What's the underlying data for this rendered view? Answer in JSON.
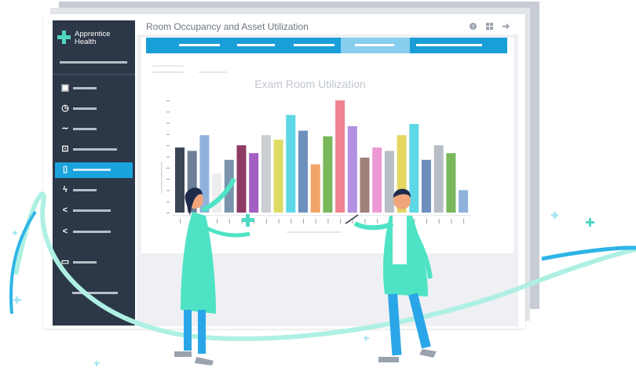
{
  "window": {
    "title": "Room Occupancy and Asset Utilization",
    "toolbar_icons": [
      "help-icon",
      "grid-icon",
      "logout-icon"
    ]
  },
  "brand": {
    "name_line1": "Apprentice",
    "name_line2": "Health",
    "accent": "#1aa3dc",
    "logo_color": "#4fd8c4",
    "sidebar_color": "#2c3747"
  },
  "sidebar": {
    "active_index": 4,
    "items": [
      {
        "icon": "dashboard-icon"
      },
      {
        "icon": "clock-icon"
      },
      {
        "icon": "trend-icon"
      },
      {
        "icon": "building-icon"
      },
      {
        "icon": "clipboard-icon"
      },
      {
        "icon": "lightning-icon"
      },
      {
        "icon": "share-icon"
      },
      {
        "icon": "share-icon"
      },
      {
        "icon": "monitor-icon"
      }
    ]
  },
  "tabs": {
    "count": 5,
    "active_index": 3
  },
  "chart_data": {
    "type": "bar",
    "title": "Exam Room Utilization",
    "ylim": [
      0,
      100
    ],
    "values": [
      58,
      55,
      69,
      35,
      47,
      60,
      53,
      69,
      65,
      87,
      73,
      43,
      68,
      100,
      77,
      49,
      58,
      55,
      69,
      79,
      47,
      60,
      53,
      20
    ],
    "colors": [
      "#3a4656",
      "#6d7f96",
      "#8fb2dd",
      "#eceef0",
      "#7a94ad",
      "#8e3b66",
      "#a35fc1",
      "#cbced3",
      "#dedc64",
      "#5ed8e6",
      "#6d8fbd",
      "#f0a466",
      "#79b85b",
      "#f0838f",
      "#b191e0",
      "#a08079",
      "#ec9ad5",
      "#b8bec6",
      "#e5d760",
      "#5ed8e6",
      "#6d8fbd",
      "#b8bec6",
      "#79b85b",
      "#8fb2dd"
    ]
  }
}
